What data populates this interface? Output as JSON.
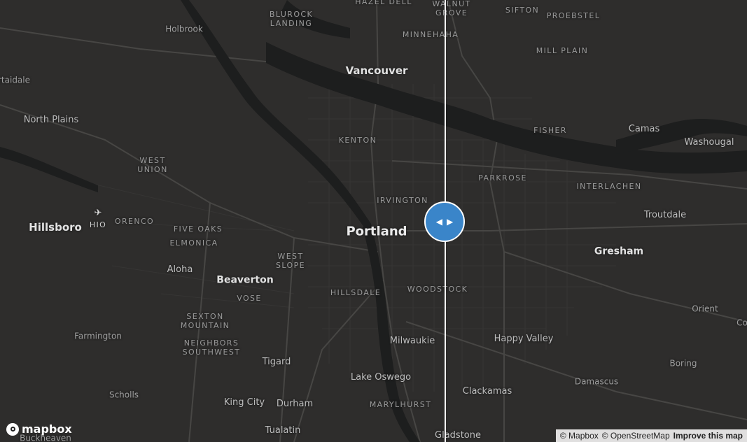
{
  "map": {
    "colors": {
      "land": "#2e2d2c",
      "water": "#1d1e1e",
      "road": "#474644",
      "minor_road": "#3b3a39",
      "accent": "#3a85c9"
    },
    "labels": {
      "hazel_dell": "HAZEL DELL",
      "walnut_grove_a": "WALNUT",
      "walnut_grove_b": "GROVE",
      "sifton": "SIFTON",
      "proebstel": "PROEBSTEL",
      "blurock_a": "BLUROCK",
      "blurock_b": "LANDING",
      "holbrook": "Holbrook",
      "minnehaha": "MINNEHAHA",
      "mill_plain": "MILL PLAIN",
      "vancouver": "Vancouver",
      "rtaidale": "rtaidale",
      "north_plains": "North Plains",
      "fisher": "FISHER",
      "camas": "Camas",
      "washougal": "Washougal",
      "kenton": "KENTON",
      "west_union_a": "WEST",
      "west_union_b": "UNION",
      "parkrose": "PARKROSE",
      "interlachen": "INTERLACHEN",
      "irvington": "IRVINGTON",
      "troutdale": "Troutdale",
      "hillsboro": "Hillsboro",
      "hio": "HIO",
      "orenco": "ORENCO",
      "five_oaks": "FIVE OAKS",
      "portland": "Portland",
      "elmonica": "ELMONICA",
      "gresham": "Gresham",
      "west_slope_a": "WEST",
      "west_slope_b": "SLOPE",
      "aloha": "Aloha",
      "beaverton": "Beaverton",
      "woodstock": "WOODSTOCK",
      "hillsdale": "HILLSDALE",
      "vose": "VOSE",
      "orient": "Orient",
      "sexton_a": "SEXTON",
      "sexton_b": "MOUNTAIN",
      "co": "Co",
      "farmington": "Farmington",
      "milwaukie": "Milwaukie",
      "happy_valley": "Happy Valley",
      "neighbors_a": "NEIGHBORS",
      "neighbors_b": "SOUTHWEST",
      "tigard": "Tigard",
      "boring": "Boring",
      "lake_oswego": "Lake Oswego",
      "damascus": "Damascus",
      "scholls": "Scholls",
      "clackamas": "Clackamas",
      "king_city": "King City",
      "durham": "Durham",
      "marylhurst": "MARYLHURST",
      "tualatin": "Tualatin",
      "gladstone": "Gladstone",
      "buckheaven": "Buckheaven"
    }
  },
  "compare": {
    "swipe_position_percent": 59.6
  },
  "logo": {
    "text": "mapbox"
  },
  "attribution": {
    "mapbox": "© Mapbox",
    "osm": "© OpenStreetMap",
    "improve": "Improve this map"
  },
  "icons": {
    "airport": "airport-icon",
    "left": "arrow-left-icon",
    "right": "arrow-right-icon"
  }
}
